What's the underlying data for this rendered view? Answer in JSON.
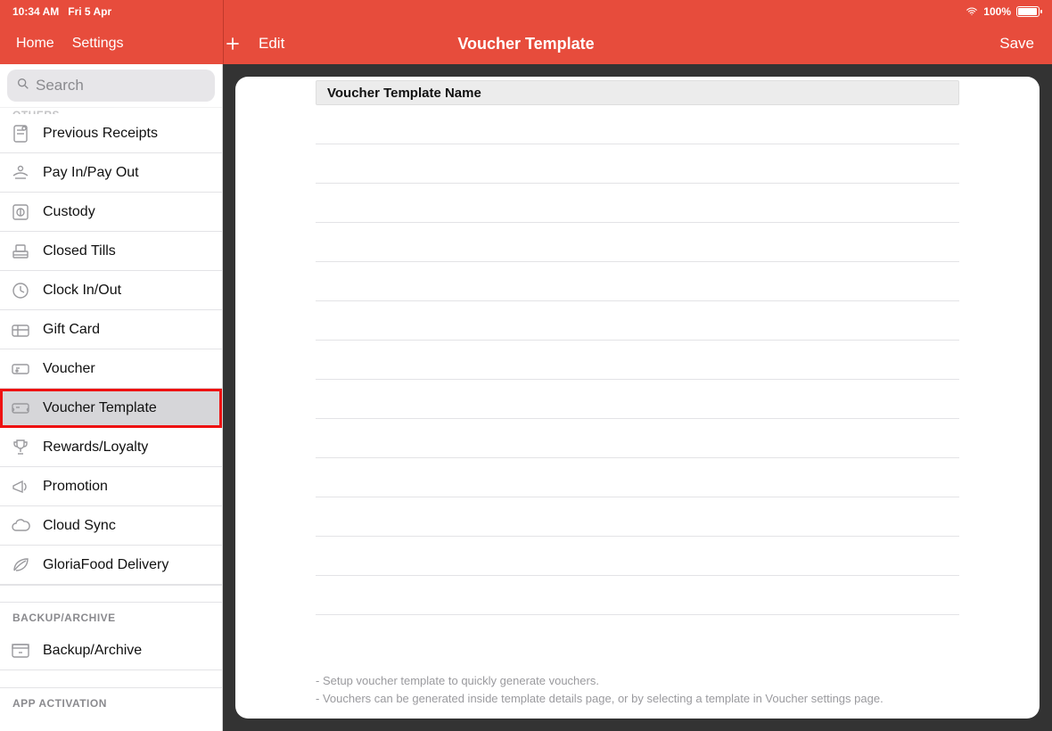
{
  "statusbar": {
    "time": "10:34 AM",
    "date": "Fri 5 Apr",
    "battery_pct": "100%"
  },
  "nav": {
    "home": "Home",
    "settings": "Settings",
    "edit": "Edit",
    "title": "Voucher Template",
    "save": "Save"
  },
  "search": {
    "placeholder": "Search"
  },
  "sidebar": {
    "partial_section_top": "OTHERS",
    "items": [
      {
        "label": "Previous Receipts",
        "icon": "receipt"
      },
      {
        "label": "Pay In/Pay Out",
        "icon": "payinout"
      },
      {
        "label": "Custody",
        "icon": "safe"
      },
      {
        "label": "Closed Tills",
        "icon": "till"
      },
      {
        "label": "Clock In/Out",
        "icon": "clock"
      },
      {
        "label": "Gift Card",
        "icon": "giftcard"
      },
      {
        "label": "Voucher",
        "icon": "voucher"
      },
      {
        "label": "Voucher Template",
        "icon": "voucher-template",
        "selected": true
      },
      {
        "label": "Rewards/Loyalty",
        "icon": "trophy"
      },
      {
        "label": "Promotion",
        "icon": "megaphone"
      },
      {
        "label": "Cloud Sync",
        "icon": "cloud"
      },
      {
        "label": "GloriaFood Delivery",
        "icon": "leaf"
      }
    ],
    "section_backup": "BACKUP/ARCHIVE",
    "backup_item": {
      "label": "Backup/Archive",
      "icon": "archive"
    },
    "section_activation": "APP ACTIVATION"
  },
  "table": {
    "header": "Voucher Template Name",
    "row_count": 13
  },
  "footer": {
    "line1": "- Setup voucher template to quickly generate vouchers.",
    "line2": "- Vouchers can be generated inside template details page, or by selecting a template in Voucher settings page."
  }
}
